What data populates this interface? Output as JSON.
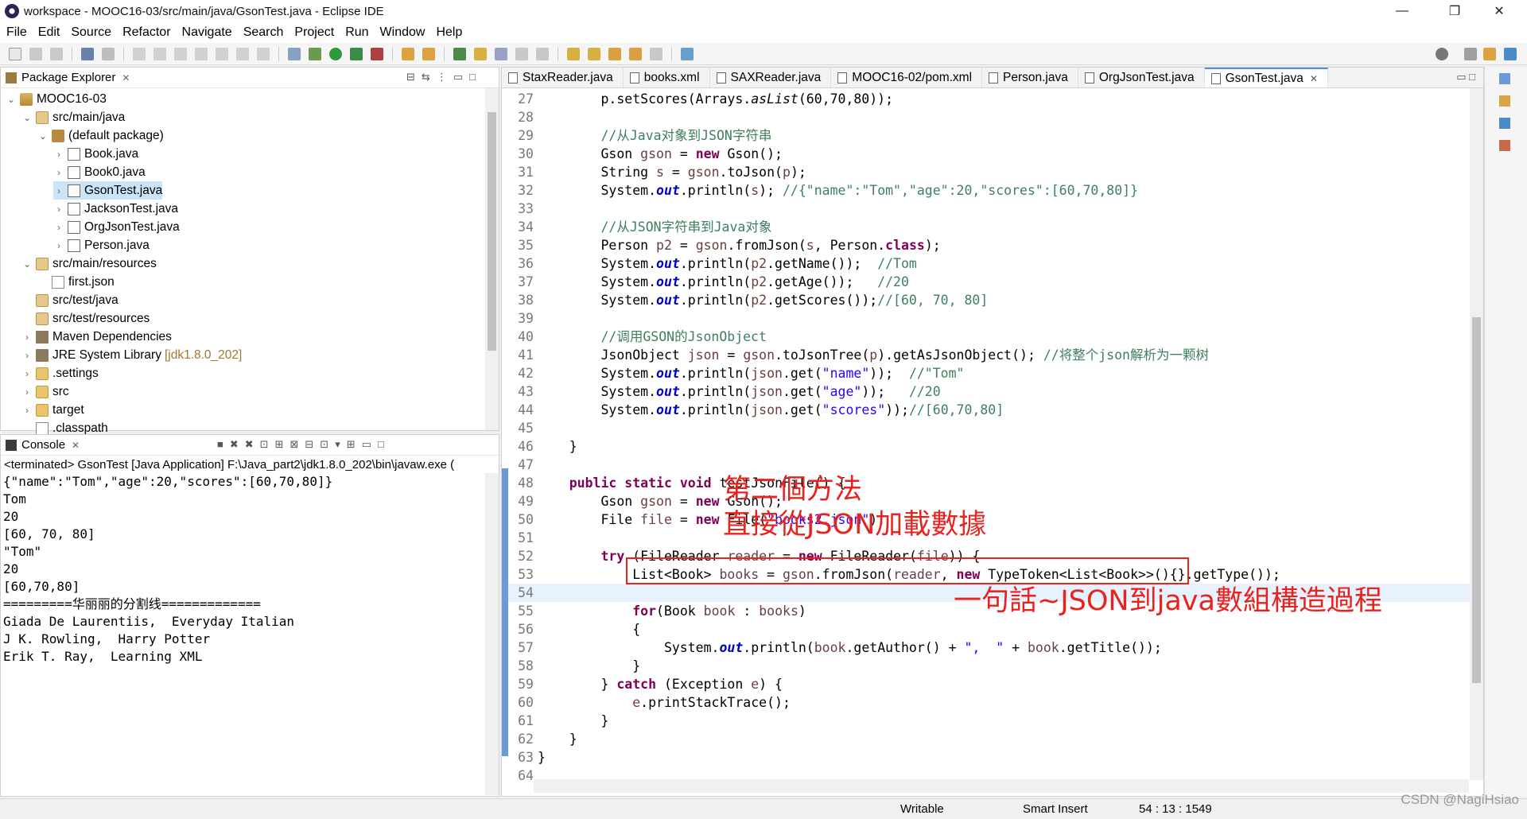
{
  "window": {
    "title": "workspace - MOOC16-03/src/main/java/GsonTest.java - Eclipse IDE",
    "minimize": "—",
    "maximize": "❐",
    "close": "✕"
  },
  "menu": [
    "File",
    "Edit",
    "Source",
    "Refactor",
    "Navigate",
    "Search",
    "Project",
    "Run",
    "Window",
    "Help"
  ],
  "package_explorer": {
    "title": "Package Explorer",
    "close": "✕",
    "tree": [
      {
        "label": "MOOC16-03",
        "twisty": "⌄",
        "icon": "project-icon"
      },
      {
        "label": "src/main/java",
        "twisty": "⌄",
        "icon": "source-folder-icon"
      },
      {
        "label": "(default package)",
        "twisty": "⌄",
        "icon": "package-icon"
      },
      {
        "label": "Book.java",
        "twisty": "›",
        "icon": "java-file-icon"
      },
      {
        "label": "Book0.java",
        "twisty": "›",
        "icon": "java-file-icon"
      },
      {
        "label": "GsonTest.java",
        "twisty": "›",
        "icon": "java-file-icon"
      },
      {
        "label": "JacksonTest.java",
        "twisty": "›",
        "icon": "java-file-icon"
      },
      {
        "label": "OrgJsonTest.java",
        "twisty": "›",
        "icon": "java-file-icon"
      },
      {
        "label": "Person.java",
        "twisty": "›",
        "icon": "java-file-icon"
      },
      {
        "label": "src/main/resources",
        "twisty": "⌄",
        "icon": "source-folder-icon"
      },
      {
        "label": "first.json",
        "twisty": "",
        "icon": "file-icon"
      },
      {
        "label": "src/test/java",
        "twisty": "",
        "icon": "source-folder-icon"
      },
      {
        "label": "src/test/resources",
        "twisty": "",
        "icon": "source-folder-icon"
      },
      {
        "label": "Maven Dependencies",
        "twisty": "›",
        "icon": "library-icon"
      },
      {
        "label": "JRE System Library",
        "decor": "[jdk1.8.0_202]",
        "twisty": "›",
        "icon": "library-icon"
      },
      {
        "label": ".settings",
        "twisty": "›",
        "icon": "folder-icon"
      },
      {
        "label": "src",
        "twisty": "›",
        "icon": "folder-icon"
      },
      {
        "label": "target",
        "twisty": "›",
        "icon": "folder-icon"
      },
      {
        "label": ".classpath",
        "twisty": "",
        "icon": "file-icon"
      }
    ]
  },
  "console": {
    "title": "Console",
    "close": "✕",
    "status": "<terminated> GsonTest [Java Application] F:\\Java_part2\\jdk1.8.0_202\\bin\\javaw.exe (",
    "output": "{\"name\":\"Tom\",\"age\":20,\"scores\":[60,70,80]}\nTom\n20\n[60, 70, 80]\n\"Tom\"\n20\n[60,70,80]\n=========华丽丽的分割线=============\nGiada De Laurentiis,  Everyday Italian\nJ K. Rowling,  Harry Potter\nErik T. Ray,  Learning XML"
  },
  "editor": {
    "tabs": [
      {
        "label": "StaxReader.java",
        "active": false
      },
      {
        "label": "books.xml",
        "active": false
      },
      {
        "label": "SAXReader.java",
        "active": false
      },
      {
        "label": "MOOC16-02/pom.xml",
        "active": false
      },
      {
        "label": "Person.java",
        "active": false
      },
      {
        "label": "OrgJsonTest.java",
        "active": false
      },
      {
        "label": "GsonTest.java",
        "active": true,
        "close": "✕"
      }
    ],
    "lines": [
      {
        "n": "27",
        "html": "        p.setScores(Arrays.<span class=\"it\">asList</span>(60,70,80));"
      },
      {
        "n": "28",
        "html": ""
      },
      {
        "n": "29",
        "html": "        <span class=\"cm\">//从Java对象到JSON字符串</span>"
      },
      {
        "n": "30",
        "html": "        Gson <span class=\"var\">gson</span> = <span class=\"kw\">new</span> Gson();"
      },
      {
        "n": "31",
        "html": "        String <span class=\"var\">s</span> = <span class=\"var\">gson</span>.toJson(<span class=\"var\">p</span>);"
      },
      {
        "n": "32",
        "html": "        System.<span class=\"fld\">out</span>.println(<span class=\"var\">s</span>); <span class=\"cm\">//{\"name\":\"Tom\",\"age\":20,\"scores\":[60,70,80]}</span>"
      },
      {
        "n": "33",
        "html": ""
      },
      {
        "n": "34",
        "html": "        <span class=\"cm\">//从JSON字符串到Java对象</span>"
      },
      {
        "n": "35",
        "html": "        Person <span class=\"var\">p2</span> = <span class=\"var\">gson</span>.fromJson(<span class=\"var\">s</span>, Person.<span class=\"kw\">class</span>);"
      },
      {
        "n": "36",
        "html": "        System.<span class=\"fld\">out</span>.println(<span class=\"var\">p2</span>.getName());  <span class=\"cm\">//Tom</span>"
      },
      {
        "n": "37",
        "html": "        System.<span class=\"fld\">out</span>.println(<span class=\"var\">p2</span>.getAge());   <span class=\"cm\">//20</span>"
      },
      {
        "n": "38",
        "html": "        System.<span class=\"fld\">out</span>.println(<span class=\"var\">p2</span>.getScores());<span class=\"cm\">//[60, 70, 80]</span>"
      },
      {
        "n": "39",
        "html": ""
      },
      {
        "n": "40",
        "html": "        <span class=\"cm\">//调用GSON的JsonObject</span>"
      },
      {
        "n": "41",
        "html": "        JsonObject <span class=\"var\">json</span> = <span class=\"var\">gson</span>.toJsonTree(<span class=\"var\">p</span>).getAsJsonObject(); <span class=\"cm\">//将整个json解析为一颗树</span>"
      },
      {
        "n": "42",
        "html": "        System.<span class=\"fld\">out</span>.println(<span class=\"var\">json</span>.get(<span class=\"st\">\"name\"</span>));  <span class=\"cm\">//\"Tom\"</span>"
      },
      {
        "n": "43",
        "html": "        System.<span class=\"fld\">out</span>.println(<span class=\"var\">json</span>.get(<span class=\"st\">\"age\"</span>));   <span class=\"cm\">//20</span>"
      },
      {
        "n": "44",
        "html": "        System.<span class=\"fld\">out</span>.println(<span class=\"var\">json</span>.get(<span class=\"st\">\"scores\"</span>));<span class=\"cm\">//[60,70,80]</span>"
      },
      {
        "n": "45",
        "html": ""
      },
      {
        "n": "46",
        "html": "    }"
      },
      {
        "n": "47",
        "html": ""
      },
      {
        "n": "48",
        "html": "    <span class=\"kw\">public</span> <span class=\"kw\">static</span> <span class=\"kw\">void</span> testJsonFile() {"
      },
      {
        "n": "49",
        "html": "        Gson <span class=\"var\">gson</span> = <span class=\"kw\">new</span> Gson();"
      },
      {
        "n": "50",
        "html": "        File <span class=\"var\">file</span> = <span class=\"kw\">new</span> File(<span class=\"st\">\"books2.json\"</span>);"
      },
      {
        "n": "51",
        "html": ""
      },
      {
        "n": "52",
        "html": "        <span class=\"kw\">try</span> (FileReader <span class=\"var\">reader</span> = <span class=\"kw\">new</span> FileReader(<span class=\"var\">file</span>)) {"
      },
      {
        "n": "53",
        "html": "            List&lt;Book&gt; <span class=\"var\">books</span> = <span class=\"var\">gson</span>.fromJson(<span class=\"var\">reader</span>, <span class=\"kw\">new</span> TypeToken&lt;List&lt;Book&gt;&gt;(){}.getType());"
      },
      {
        "n": "54",
        "html": ""
      },
      {
        "n": "55",
        "html": "            <span class=\"kw\">for</span>(Book <span class=\"var\">book</span> : <span class=\"var\">books</span>)"
      },
      {
        "n": "56",
        "html": "            {"
      },
      {
        "n": "57",
        "html": "                System.<span class=\"fld\">out</span>.println(<span class=\"var\">book</span>.getAuthor() + <span class=\"st\">\",  \"</span> + <span class=\"var\">book</span>.getTitle());"
      },
      {
        "n": "58",
        "html": "            }"
      },
      {
        "n": "59",
        "html": "        } <span class=\"kw\">catch</span> (Exception <span class=\"var\">e</span>) {"
      },
      {
        "n": "60",
        "html": "            <span class=\"var\">e</span>.printStackTrace();"
      },
      {
        "n": "61",
        "html": "        }"
      },
      {
        "n": "62",
        "html": "    }"
      },
      {
        "n": "63",
        "html": "}"
      },
      {
        "n": "64",
        "html": ""
      }
    ],
    "annotations": {
      "a1": "第二個方法",
      "a2": "直接從JSON加載數據",
      "a3": "一句話~JSON到java數組構造過程"
    }
  },
  "status": {
    "writable": "Writable",
    "insert_mode": "Smart Insert",
    "position": "54 : 13 : 1549"
  },
  "watermark": "CSDN @NagiHsiao"
}
